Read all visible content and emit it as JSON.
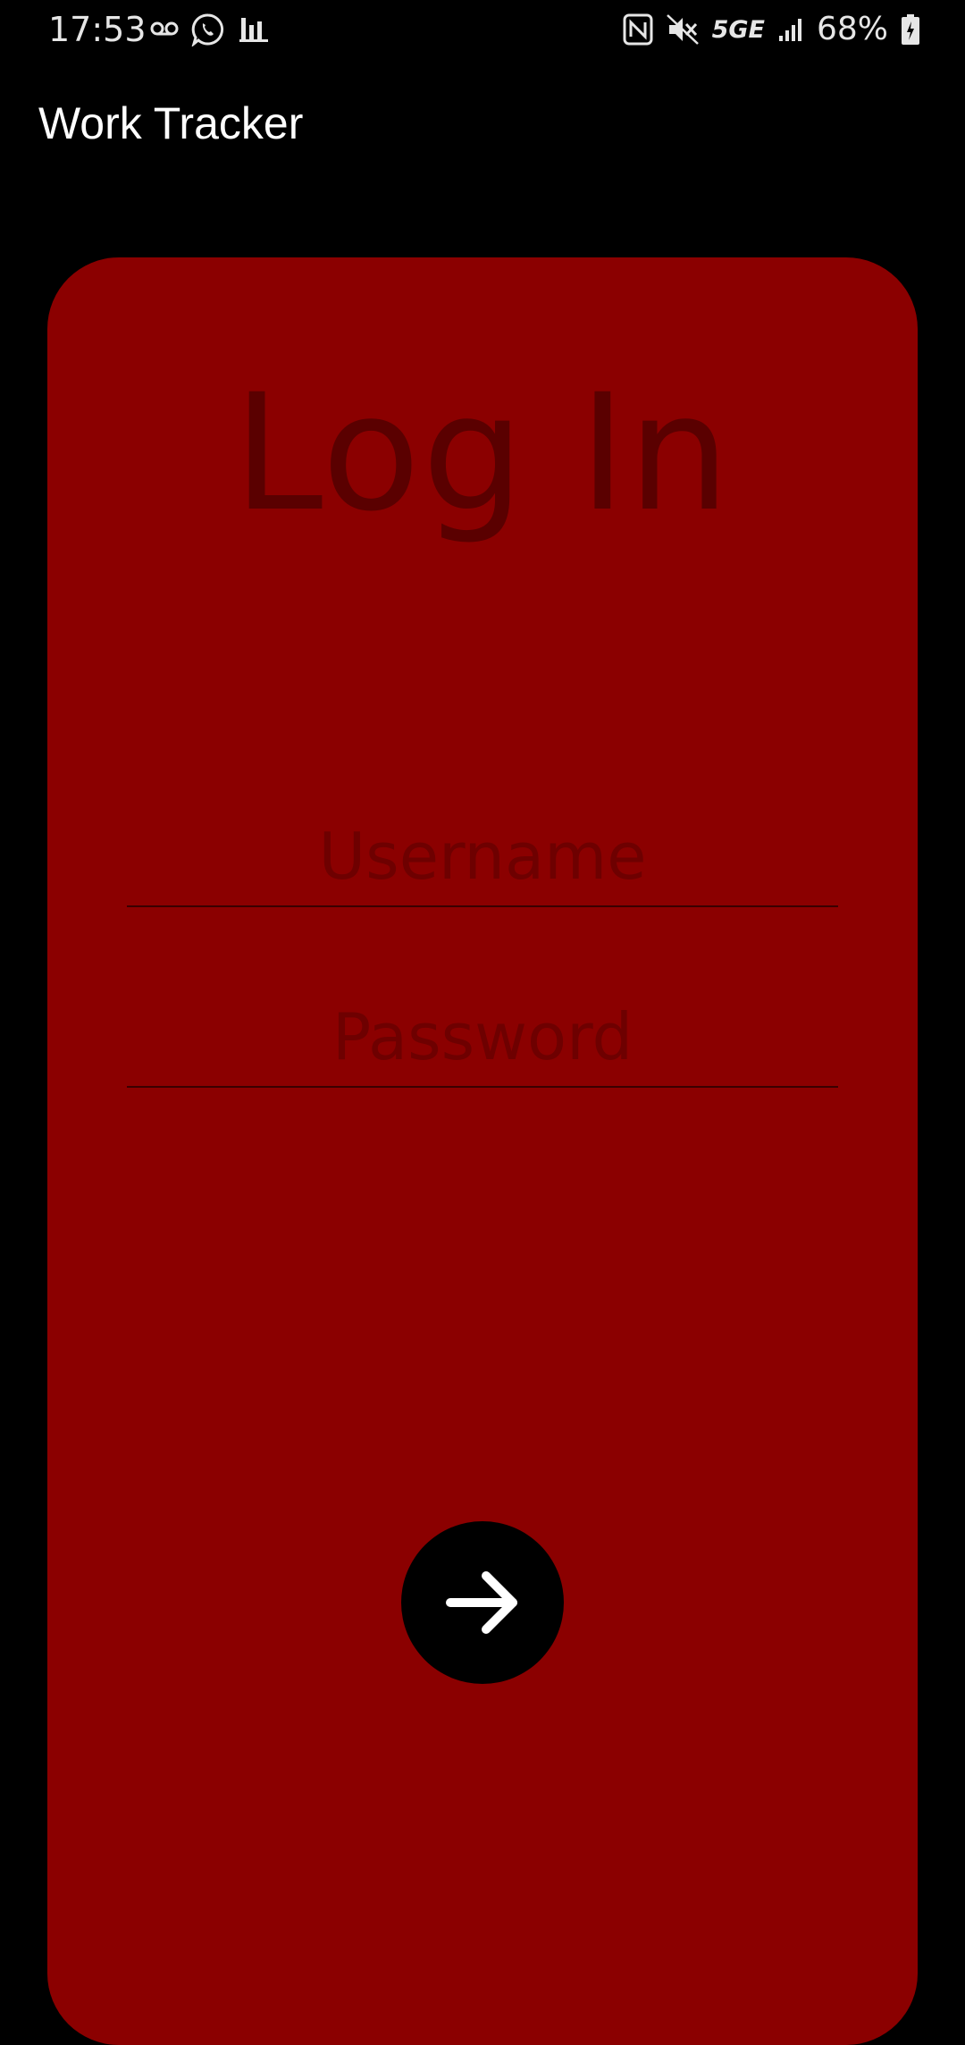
{
  "status_bar": {
    "time": "17:53",
    "left_icons": [
      "voicemail-icon",
      "whatsapp-icon",
      "bar-chart-icon"
    ],
    "right_icons": [
      "nfc-icon",
      "mute-icon",
      "signal-icon",
      "battery-icon"
    ],
    "network": "5GE",
    "battery_percent": "68%"
  },
  "app_bar": {
    "title": "Work Tracker"
  },
  "login_card": {
    "heading": "Log In",
    "username_placeholder": "Username",
    "username_value": "",
    "password_placeholder": "Password",
    "password_value": "",
    "submit_icon": "arrow-right-icon"
  },
  "colors": {
    "background": "#000000",
    "card": "#8b0000",
    "heading_text": "#5a0000",
    "placeholder_text": "#6e0000",
    "button": "#000000",
    "button_icon": "#ffffff"
  }
}
